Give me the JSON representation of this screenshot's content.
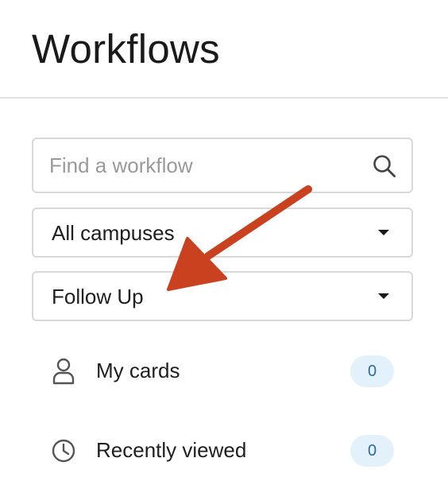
{
  "header": {
    "title": "Workflows"
  },
  "search": {
    "placeholder": "Find a workflow",
    "value": "",
    "icon": "search-icon"
  },
  "filters": {
    "campus": {
      "selected": "All campuses"
    },
    "stage": {
      "selected": "Follow Up"
    }
  },
  "nav": {
    "items": [
      {
        "label": "My cards",
        "count": "0",
        "icon": "person-icon"
      },
      {
        "label": "Recently viewed",
        "count": "0",
        "icon": "clock-icon"
      }
    ]
  },
  "annotation": {
    "color": "#c9411f",
    "icon": "pointer-arrow"
  },
  "colors": {
    "badge_bg": "#e3f1fb",
    "badge_text": "#2b6aa6",
    "border": "#d9d9d9"
  }
}
